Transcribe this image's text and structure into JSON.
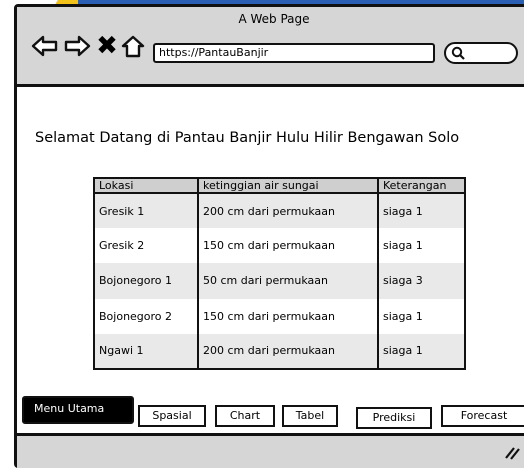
{
  "window": {
    "title": "A Web Page"
  },
  "toolbar": {
    "back_icon": "arrow-left-icon",
    "forward_icon": "arrow-right-icon",
    "close_icon": "close-icon",
    "close_glyph": "✖",
    "home_icon": "home-icon",
    "url": "https://PantauBanjir",
    "search_icon": "search-icon"
  },
  "main": {
    "heading": "Selamat Datang di Pantau Banjir Hulu Hilir Bengawan Solo"
  },
  "table": {
    "headers": [
      "Lokasi",
      "ketinggian air sungai",
      "Keterangan"
    ],
    "rows": [
      [
        "Gresik 1",
        "200 cm dari permukaan",
        "siaga 1"
      ],
      [
        "Gresik 2",
        "150 cm dari permukaan",
        "siaga 1"
      ],
      [
        "Bojonegoro 1",
        "50 cm dari permukaan",
        "siaga 3"
      ],
      [
        "Bojonegoro 2",
        "150 cm dari permukaan",
        "siaga 1"
      ],
      [
        "Ngawi 1",
        "200 cm dari permukaan",
        "siaga 1"
      ]
    ]
  },
  "menu": {
    "tabs": [
      "Menu Utama",
      "Spasial",
      "Chart",
      "Tabel",
      "Prediksi",
      "Forecast"
    ],
    "active": "Menu Utama"
  },
  "colors": {
    "accent_blue": "#2b5fb3",
    "accent_yellow": "#f2c21b",
    "chrome_gray": "#d6d6d6",
    "header_gray": "#cfcfcf",
    "row_shade": "#e9e9e9"
  }
}
